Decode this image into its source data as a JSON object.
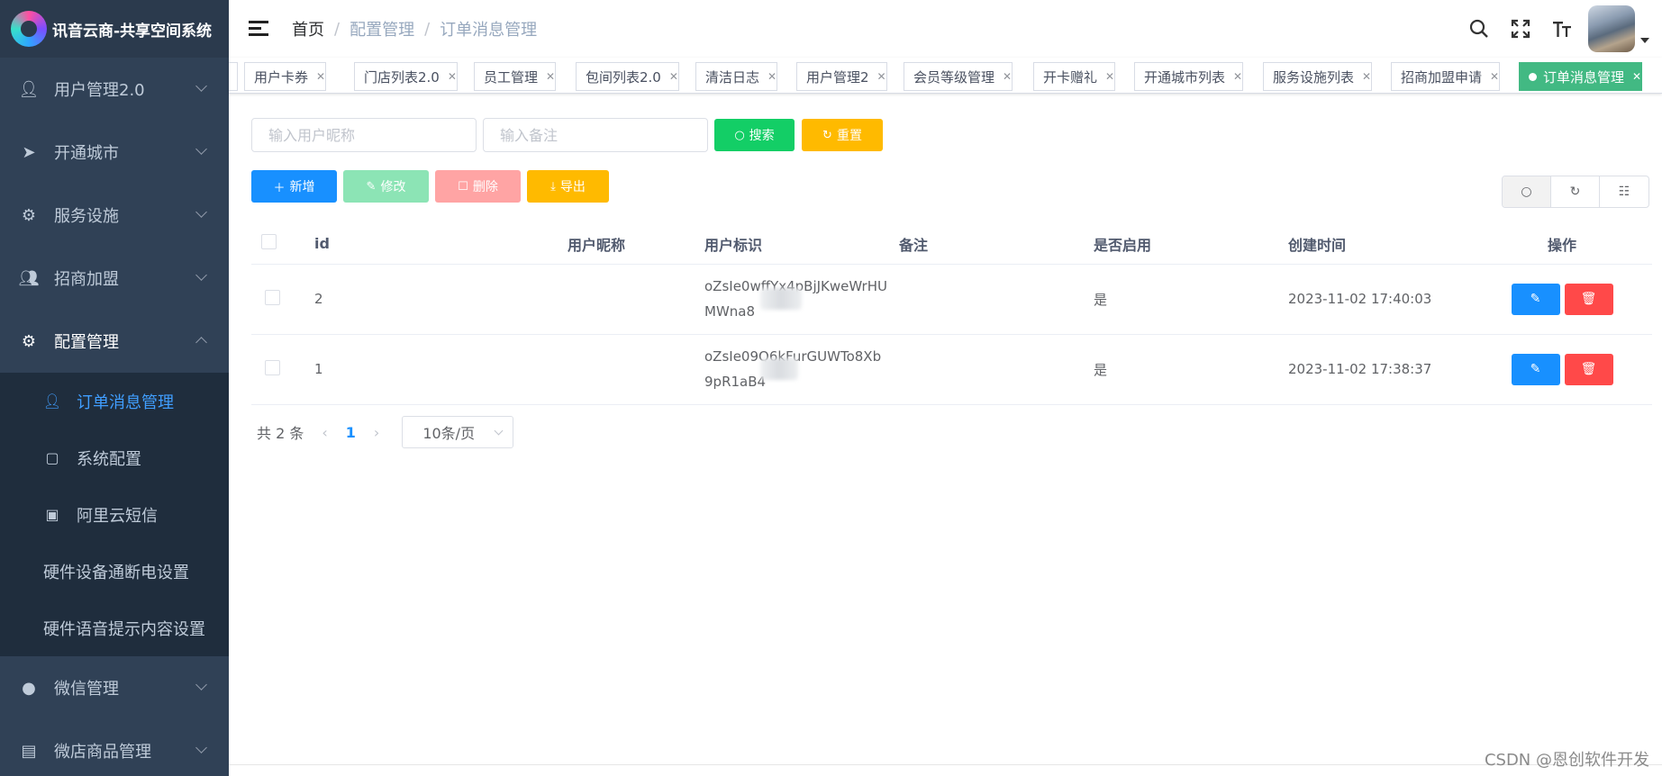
{
  "app": {
    "title": "讯音云商-共享空间系统"
  },
  "sidebar": {
    "items": [
      {
        "label": "用户管理2.0",
        "icon": "users-icon"
      },
      {
        "label": "开通城市",
        "icon": "send-icon"
      },
      {
        "label": "服务设施",
        "icon": "gear-icon"
      },
      {
        "label": "招商加盟",
        "icon": "users-icon"
      },
      {
        "label": "配置管理",
        "icon": "gear-icon",
        "open": true
      },
      {
        "label": "微信管理",
        "icon": "wechat-icon"
      },
      {
        "label": "微店商品管理",
        "icon": "shop-icon"
      }
    ],
    "submenu": [
      {
        "label": "订单消息管理",
        "icon": "users-icon",
        "active": true
      },
      {
        "label": "系统配置",
        "icon": "box-icon"
      },
      {
        "label": "阿里云短信",
        "icon": "briefcase-icon"
      },
      {
        "label": "硬件设备通断电设置"
      },
      {
        "label": "硬件语音提示内容设置"
      }
    ]
  },
  "breadcrumb": {
    "home": "首页",
    "sep": "/",
    "level1": "配置管理",
    "level2": "订单消息管理"
  },
  "tags": [
    {
      "label": ""
    },
    {
      "label": "用户卡券"
    },
    {
      "label": "门店列表2.0"
    },
    {
      "label": "员工管理"
    },
    {
      "label": "包间列表2.0"
    },
    {
      "label": "清洁日志"
    },
    {
      "label": "用户管理2"
    },
    {
      "label": "会员等级管理"
    },
    {
      "label": "开卡赠礼"
    },
    {
      "label": "开通城市列表"
    },
    {
      "label": "服务设施列表"
    },
    {
      "label": "招商加盟申请"
    },
    {
      "label": "订单消息管理",
      "active": true
    }
  ],
  "search": {
    "nickname_placeholder": "输入用户昵称",
    "remark_placeholder": "输入备注",
    "search_label": "搜索",
    "reset_label": "重置"
  },
  "toolbar": {
    "add_label": "新增",
    "edit_label": "修改",
    "delete_label": "删除",
    "export_label": "导出"
  },
  "table": {
    "columns": [
      "id",
      "用户昵称",
      "用户标识",
      "备注",
      "是否启用",
      "创建时间",
      "操作"
    ],
    "rows": [
      {
        "id": "2",
        "openid_line1": "oZsIe0wffYx4pBjJKweWrHU",
        "openid_line2": "MWna8",
        "remark": "",
        "enabled": "是",
        "created": "2023-11-02 17:40:03"
      },
      {
        "id": "1",
        "openid_line1": "oZsIe09Q6kFurGUWTo8Xb",
        "openid_line2": "9pR1aB4",
        "remark": "",
        "enabled": "是",
        "created": "2023-11-02 17:38:37"
      }
    ]
  },
  "pagination": {
    "total": "共 2 条",
    "current": "1",
    "page_size": "10条/页"
  },
  "watermark": "CSDN @恩创软件开发",
  "colors": {
    "sidebar_bg": "#304156",
    "active_blue": "#409eff",
    "tag_active": "#42b983",
    "search_btn": "#13ce66",
    "reset_btn": "#ffba00",
    "add_btn": "#1890ff",
    "delete_btn": "#ff4949"
  }
}
